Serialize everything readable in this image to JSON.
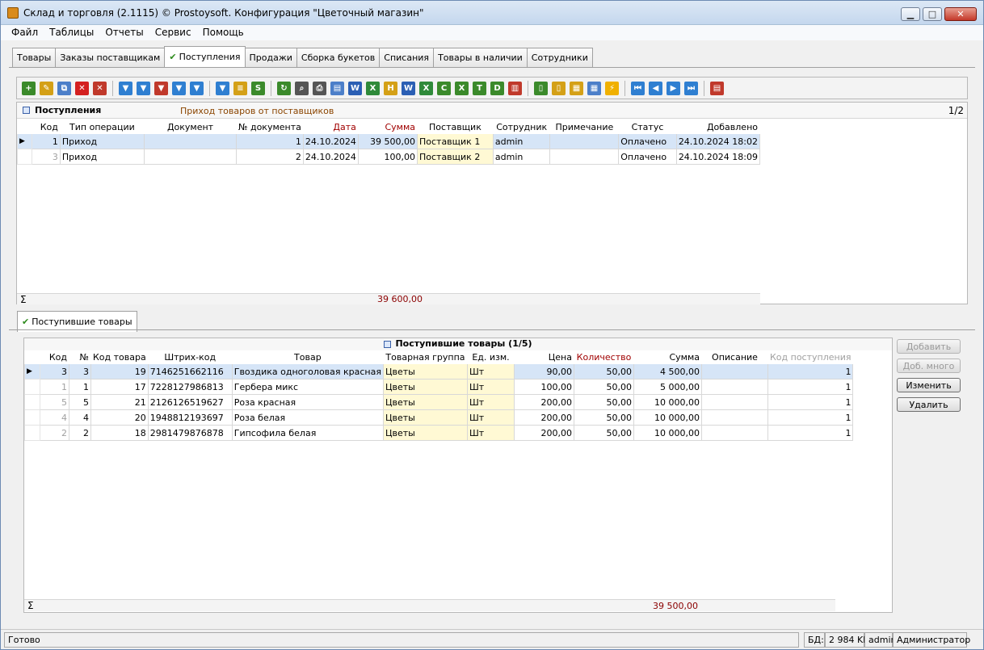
{
  "window": {
    "title": "Склад и торговля (2.1115) © Prostoysoft. Конфигурация \"Цветочный магазин\"",
    "min": "▁",
    "max": "□",
    "close": "✕"
  },
  "menu": [
    "Файл",
    "Таблицы",
    "Отчеты",
    "Сервис",
    "Помощь"
  ],
  "tabs": [
    {
      "label": "Товары",
      "active": false
    },
    {
      "label": "Заказы поставщикам",
      "active": false
    },
    {
      "label": "Поступления",
      "active": true
    },
    {
      "label": "Продажи",
      "active": false
    },
    {
      "label": "Сборка букетов",
      "active": false
    },
    {
      "label": "Списания",
      "active": false
    },
    {
      "label": "Товары в наличии",
      "active": false
    },
    {
      "label": "Сотрудники",
      "active": false
    }
  ],
  "toolbar": [
    {
      "icon": "add-icon",
      "color": "#3b8a2b",
      "glyph": "+"
    },
    {
      "icon": "edit-icon",
      "color": "#d4a017",
      "glyph": "✎"
    },
    {
      "icon": "copy-icon",
      "color": "#4c7fc9",
      "glyph": "⧉"
    },
    {
      "icon": "delete-icon",
      "color": "#d42020",
      "glyph": "✕"
    },
    {
      "icon": "delete-all-icon",
      "color": "#c0392b",
      "glyph": "✕"
    },
    {
      "sep": true
    },
    {
      "icon": "filter-icon",
      "color": "#2f7fd1",
      "glyph": "▼"
    },
    {
      "icon": "filter-clear-icon",
      "color": "#2f7fd1",
      "glyph": "▼"
    },
    {
      "icon": "filter-remove-icon",
      "color": "#c0392b",
      "glyph": "▼"
    },
    {
      "icon": "filter-edit-icon",
      "color": "#2f7fd1",
      "glyph": "▼"
    },
    {
      "icon": "filter-advanced-icon",
      "color": "#2f7fd1",
      "glyph": "▼"
    },
    {
      "sep": true
    },
    {
      "icon": "filter-group-icon",
      "color": "#2f7fd1",
      "glyph": "▼"
    },
    {
      "icon": "tree-icon",
      "color": "#d4a017",
      "glyph": "≡"
    },
    {
      "icon": "sql-icon",
      "color": "#3b8a2b",
      "glyph": "S"
    },
    {
      "sep": true
    },
    {
      "icon": "refresh-icon",
      "color": "#3b8a2b",
      "glyph": "↻"
    },
    {
      "icon": "search-icon",
      "color": "#555555",
      "glyph": "⌕"
    },
    {
      "icon": "print-icon",
      "color": "#555555",
      "glyph": "⎙"
    },
    {
      "icon": "preview-icon",
      "color": "#4c7fc9",
      "glyph": "▤"
    },
    {
      "icon": "export-word-icon",
      "color": "#2b5fb4",
      "glyph": "W"
    },
    {
      "icon": "export-excel-icon",
      "color": "#2f8a3a",
      "glyph": "X"
    },
    {
      "icon": "export-html-icon",
      "color": "#d4a017",
      "glyph": "H"
    },
    {
      "icon": "export-word2-icon",
      "color": "#2b5fb4",
      "glyph": "W"
    },
    {
      "icon": "export-excel2-icon",
      "color": "#2f8a3a",
      "glyph": "X"
    },
    {
      "icon": "export-csv-icon",
      "color": "#3b8a2b",
      "glyph": "C"
    },
    {
      "icon": "export-xml-icon",
      "color": "#3b8a2b",
      "glyph": "X"
    },
    {
      "icon": "export-txt-icon",
      "color": "#3b8a2b",
      "glyph": "T"
    },
    {
      "icon": "export-dbf-icon",
      "color": "#3b8a2b",
      "glyph": "D"
    },
    {
      "icon": "chart-icon",
      "color": "#c0392b",
      "glyph": "▥"
    },
    {
      "sep": true
    },
    {
      "icon": "doc-icon",
      "color": "#3b8a2b",
      "glyph": "▯"
    },
    {
      "icon": "doc2-icon",
      "color": "#d4a017",
      "glyph": "▯"
    },
    {
      "icon": "table-icon",
      "color": "#d4a017",
      "glyph": "▦"
    },
    {
      "icon": "table2-icon",
      "color": "#4c7fc9",
      "glyph": "▦"
    },
    {
      "icon": "lightning-icon",
      "color": "#f0b000",
      "glyph": "⚡"
    },
    {
      "sep": true
    },
    {
      "icon": "first-icon",
      "color": "#2f7fd1",
      "glyph": "⏮"
    },
    {
      "icon": "prev-icon",
      "color": "#2f7fd1",
      "glyph": "◀"
    },
    {
      "icon": "next-icon",
      "color": "#2f7fd1",
      "glyph": "▶"
    },
    {
      "icon": "last-icon",
      "color": "#2f7fd1",
      "glyph": "⏭"
    },
    {
      "sep": true
    },
    {
      "icon": "columns-icon",
      "color": "#c0392b",
      "glyph": "▤"
    }
  ],
  "receipts": {
    "title": "Поступления",
    "subtitle": "Приход товаров от поставщиков",
    "counter": "1/2",
    "columns": [
      "Код",
      "Тип операции",
      "Документ",
      "№ документа",
      "Дата",
      "Сумма",
      "Поставщик",
      "Сотрудник",
      "Примечание",
      "Статус",
      "Добавлено"
    ],
    "rows": [
      {
        "code": "1",
        "type": "Приход",
        "doc": "",
        "docno": "1",
        "date": "24.10.2024",
        "sum": "39 500,00",
        "supplier": "Поставщик 1",
        "employee": "admin",
        "note": "",
        "status": "Оплачено",
        "added": "24.10.2024 18:02"
      },
      {
        "code": "3",
        "type": "Приход",
        "doc": "",
        "docno": "2",
        "date": "24.10.2024",
        "sum": "100,00",
        "supplier": "Поставщик 2",
        "employee": "admin",
        "note": "",
        "status": "Оплачено",
        "added": "24.10.2024 18:09"
      }
    ],
    "sigma": "Σ",
    "total": "39 600,00"
  },
  "subtab": {
    "label": "Поступившие товары"
  },
  "items": {
    "title": "Поступившие товары (1/5)",
    "columns": [
      "Код",
      "№",
      "Код товара",
      "Штрих-код",
      "Товар",
      "Товарная группа",
      "Ед. изм.",
      "Цена",
      "Количество",
      "Сумма",
      "Описание",
      "Код поступления"
    ],
    "rows": [
      {
        "code": "3",
        "n": "3",
        "pcode": "19",
        "barcode": "7146251662116",
        "name": "Гвоздика одноголовая красная",
        "group": "Цветы",
        "unit": "Шт",
        "price": "90,00",
        "qty": "50,00",
        "sum": "4 500,00",
        "desc": "",
        "rcode": "1"
      },
      {
        "code": "1",
        "n": "1",
        "pcode": "17",
        "barcode": "7228127986813",
        "name": "Гербера микс",
        "group": "Цветы",
        "unit": "Шт",
        "price": "100,00",
        "qty": "50,00",
        "sum": "5 000,00",
        "desc": "",
        "rcode": "1"
      },
      {
        "code": "5",
        "n": "5",
        "pcode": "21",
        "barcode": "2126126519627",
        "name": "Роза красная",
        "group": "Цветы",
        "unit": "Шт",
        "price": "200,00",
        "qty": "50,00",
        "sum": "10 000,00",
        "desc": "",
        "rcode": "1"
      },
      {
        "code": "4",
        "n": "4",
        "pcode": "20",
        "barcode": "1948812193697",
        "name": "Роза белая",
        "group": "Цветы",
        "unit": "Шт",
        "price": "200,00",
        "qty": "50,00",
        "sum": "10 000,00",
        "desc": "",
        "rcode": "1"
      },
      {
        "code": "2",
        "n": "2",
        "pcode": "18",
        "barcode": "2981479876878",
        "name": "Гипсофила белая",
        "group": "Цветы",
        "unit": "Шт",
        "price": "200,00",
        "qty": "50,00",
        "sum": "10 000,00",
        "desc": "",
        "rcode": "1"
      }
    ],
    "sigma": "Σ",
    "total": "39 500,00"
  },
  "buttons": {
    "add": "Добавить",
    "add_many": "Доб. много",
    "edit": "Изменить",
    "delete": "Удалить"
  },
  "status": {
    "text": "Готово",
    "db_label": "БД:",
    "db_size": "2 984 Kb",
    "user": "admin",
    "role": "Администратор"
  }
}
